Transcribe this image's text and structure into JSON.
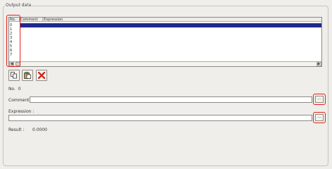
{
  "group_title": "Output data",
  "table": {
    "columns": [
      "No.",
      "Comment",
      "Expression"
    ],
    "rows": [
      "0",
      "1",
      "2",
      "3",
      "4",
      "5",
      "6",
      "7"
    ]
  },
  "toolbar": {
    "copy_icon": "copy-icon",
    "paste_icon": "paste-icon",
    "delete_icon": "delete-icon"
  },
  "details": {
    "no_label": "No.  0",
    "comment_label": "Comment :",
    "comment_value": "",
    "expression_label": "Expression :",
    "expression_value": "",
    "browse_label": "...",
    "result_label": "Result :",
    "result_value": "0.0000"
  },
  "colors": {
    "selection": "#1f2a8c",
    "highlight": "#e3201c",
    "delete": "#d22a1e"
  }
}
